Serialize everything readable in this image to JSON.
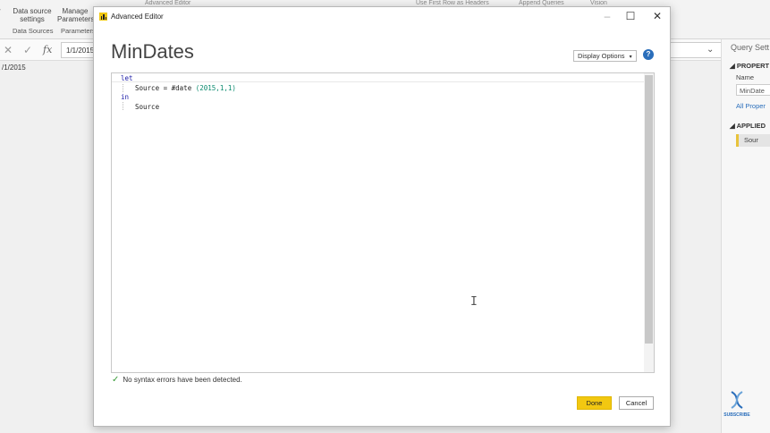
{
  "ribbon": {
    "data_source_settings": "Data source settings",
    "manage_parameters": "Manage Parameters",
    "group_data_sources": "Data Sources",
    "group_parameters": "Parameters",
    "top_truncated": "Advanced Editor",
    "top_use_first_row": "Use First Row as Headers",
    "top_append": "Append Queries",
    "top_vision": "Vision"
  },
  "formula_bar": {
    "value": "1/1/2015",
    "cell_value": "/1/2015"
  },
  "query_settings": {
    "title": "Query Sett",
    "properties_heading": "PROPERT",
    "name_label": "Name",
    "name_value": "MinDate",
    "all_properties": "All Proper",
    "applied_heading": "APPLIED",
    "step": "Sour"
  },
  "subscribe": "SUBSCRIBE",
  "dialog": {
    "title": "Advanced Editor",
    "query_name": "MinDates",
    "display_options": "Display Options",
    "help": "?",
    "code": {
      "line1": "let",
      "line2_prefix": "Source = #date ",
      "line2_args": "(2015,1,1)",
      "line3": "in",
      "line4": "Source"
    },
    "status": "No syntax errors have been detected.",
    "done": "Done",
    "cancel": "Cancel"
  },
  "colors": {
    "accent_yellow": "#f2c811",
    "keyword_blue": "#1a1aa6",
    "number_teal": "#0a8a6e",
    "ok_green": "#3a9c3a",
    "link_blue": "#2a6ebb"
  }
}
